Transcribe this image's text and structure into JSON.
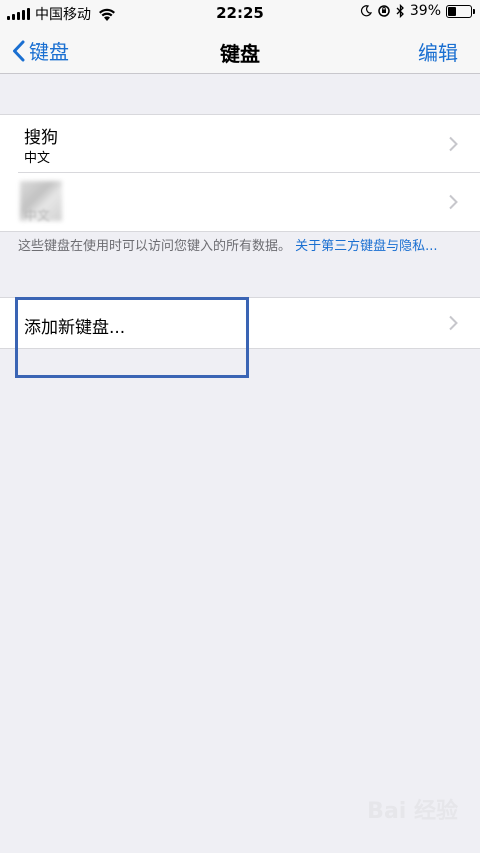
{
  "status_bar": {
    "carrier": "中国移动",
    "time": "22:25",
    "battery_percent_text": "39%",
    "battery_level": 0.39,
    "icons": [
      "signal-icon",
      "wifi-icon",
      "moon-icon",
      "orientation-lock-icon",
      "bluetooth-icon",
      "battery-icon"
    ]
  },
  "nav": {
    "back_label": "键盘",
    "title": "键盘",
    "edit_label": "编辑"
  },
  "keyboards": [
    {
      "name": "搜狗",
      "language": "中文"
    },
    {
      "name": "",
      "language": "中文"
    }
  ],
  "footer": {
    "note": "这些键盘在使用时可以访问您键入的所有数据。",
    "link": "关于第三方键盘与隐私..."
  },
  "add_keyboard": {
    "label": "添加新键盘..."
  },
  "colors": {
    "accent": "#1a6fd1",
    "background": "#efeff4",
    "highlight_box": "#3a64b4"
  }
}
